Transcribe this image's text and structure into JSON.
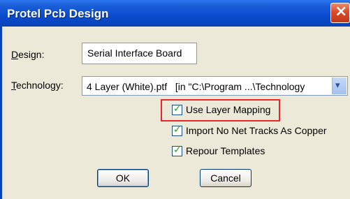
{
  "window": {
    "title": "Protel Pcb Design",
    "close_glyph": "×"
  },
  "form": {
    "design_label": "Design:",
    "design_label_accel": "D",
    "design_label_rest": "esign:",
    "design_value": "Serial Interface Board",
    "technology_label": "Technology:",
    "technology_label_accel": "T",
    "technology_label_rest": "echnology:",
    "technology_value": "4 Layer (White).ptf   [in \"C:\\Program ...\\Technology",
    "dropdown_glyph": "▾"
  },
  "options": [
    {
      "label": "Use Layer Mapping",
      "checked": true,
      "highlighted": true
    },
    {
      "label": "Import No Net Tracks As Copper",
      "checked": true,
      "highlighted": false
    },
    {
      "label": "Repour Templates",
      "checked": true,
      "highlighted": false
    }
  ],
  "check_glyph": "✓",
  "buttons": {
    "ok": "OK",
    "cancel": "Cancel"
  },
  "colors": {
    "titlebar": "#0a4bcf",
    "dialog_bg": "#ece9d8",
    "highlight": "#e8262b",
    "checkmark": "#21a121"
  }
}
